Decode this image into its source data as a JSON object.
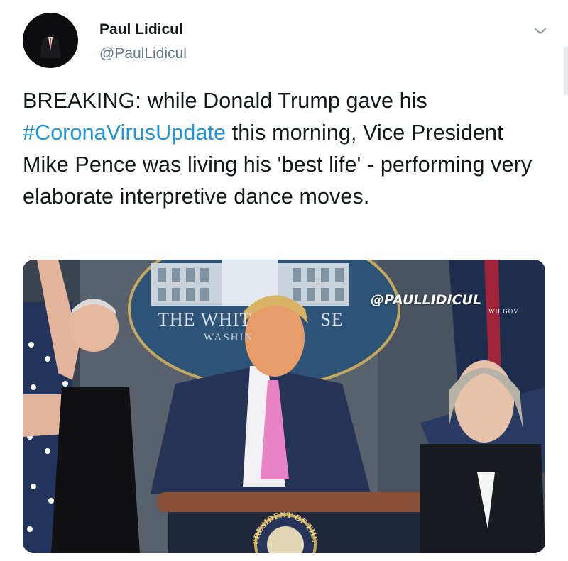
{
  "tweet": {
    "author_name": "Paul Lidicul",
    "author_handle": "@PaulLidicul",
    "text_before": "BREAKING: while Donald Trump gave his ",
    "hashtag": "#CoronaVirusUpdate",
    "text_after": " this morning, Vice President Mike Pence was living his 'best life' - performing very elaborate interpretive dance moves.",
    "link_color": "#1b95e0",
    "menu_icon": "chevron-down-icon"
  },
  "media": {
    "watermark": "@PAULLIDICUL",
    "sign_line1": "THE WHIT",
    "sign_line1b": "SE",
    "sign_line2": "WASHIN",
    "wh_gov": "WH.GOV",
    "seal_text": "PRESIDENT OF THE UNITED"
  }
}
